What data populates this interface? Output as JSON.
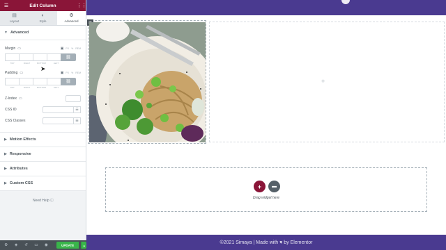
{
  "panel": {
    "header": {
      "title": "Edit Column",
      "menu_icon": "hamburger-icon",
      "grid_icon": "grid-icon"
    },
    "tabs": [
      {
        "label": "Layout",
        "icon": "layout-icon",
        "active": false
      },
      {
        "label": "Style",
        "icon": "half-circle-icon",
        "active": false
      },
      {
        "label": "Advanced",
        "icon": "gear-icon",
        "active": true
      }
    ],
    "advanced": {
      "title": "Advanced",
      "margin": {
        "label": "Margin",
        "units": [
          "PX",
          "%",
          "REM"
        ]
      },
      "padding": {
        "label": "Padding",
        "units": [
          "PX",
          "%",
          "REM"
        ]
      },
      "dimension_labels": [
        "TOP",
        "RIGHT",
        "BOTTOM",
        "LEFT"
      ],
      "z_index": {
        "label": "Z-Index",
        "value": ""
      },
      "css_id": {
        "label": "CSS ID",
        "value": ""
      },
      "css_classes": {
        "label": "CSS Classes",
        "value": ""
      }
    },
    "sections": [
      "Motion Effects",
      "Responsive",
      "Attributes",
      "Custom CSS"
    ],
    "need_help": "Need Help",
    "footer": {
      "update_label": "UPDATE"
    }
  },
  "canvas": {
    "dropzone_text": "Drag widget here",
    "footer_text": "©2021 Simaya | Made with ♥ by Elementor"
  },
  "colors": {
    "panel_header": "#8a1538",
    "site_band": "#4a3a90",
    "update": "#39b54a"
  }
}
